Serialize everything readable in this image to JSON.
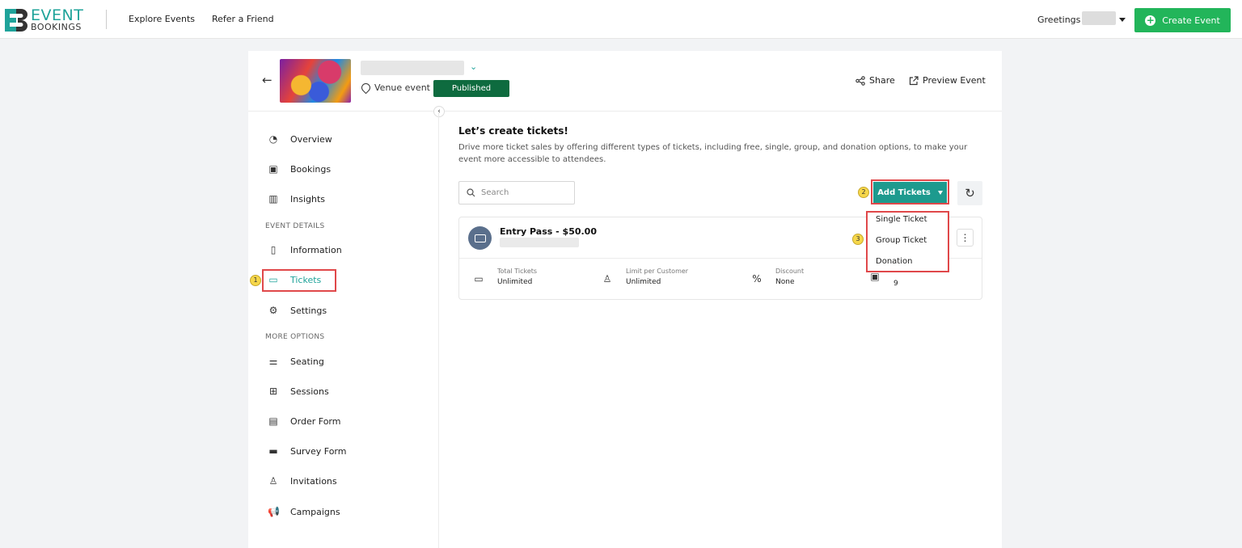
{
  "topbar": {
    "logo": {
      "event": "EVENT",
      "bookings": "BOOKINGS"
    },
    "nav": [
      {
        "label": "Explore Events"
      },
      {
        "label": "Refer a Friend"
      }
    ],
    "greeting": "Greetings!",
    "create_label": "Create Event"
  },
  "event": {
    "venue_label": "Venue event",
    "status": "Published",
    "share_label": "Share",
    "preview_label": "Preview Event"
  },
  "sidebar": {
    "items_top": [
      {
        "label": "Overview",
        "icon": "gauge-icon"
      },
      {
        "label": "Bookings",
        "icon": "calendar-icon"
      },
      {
        "label": "Insights",
        "icon": "bar-chart-icon"
      }
    ],
    "event_details_heading": "EVENT DETAILS",
    "items_details": [
      {
        "label": "Information",
        "icon": "document-icon"
      },
      {
        "label": "Tickets",
        "icon": "ticket-icon"
      },
      {
        "label": "Settings",
        "icon": "gear-icon"
      }
    ],
    "more_options_heading": "MORE OPTIONS",
    "items_more": [
      {
        "label": "Seating",
        "icon": "sliders-icon"
      },
      {
        "label": "Sessions",
        "icon": "grid-icon"
      },
      {
        "label": "Order Form",
        "icon": "form-icon"
      },
      {
        "label": "Survey Form",
        "icon": "survey-icon"
      },
      {
        "label": "Invitations",
        "icon": "user-icon"
      },
      {
        "label": "Campaigns",
        "icon": "megaphone-icon"
      }
    ]
  },
  "main": {
    "title": "Let’s create tickets!",
    "description": "Drive more ticket sales by offering different types of tickets, including free, single, group, and donation options, to make your event more accessible to attendees.",
    "search_placeholder": "Search",
    "add_tickets_label": "Add Tickets",
    "dropdown": [
      "Single Ticket",
      "Group Ticket",
      "Donation"
    ],
    "ticket": {
      "name": "Entry Pass - $50.00",
      "stats": [
        {
          "label": "Total Tickets",
          "value": "Unlimited",
          "icon": "ticket-icon"
        },
        {
          "label": "Limit per Customer",
          "value": "Unlimited",
          "icon": "user-icon"
        },
        {
          "label": "Discount",
          "value": "None",
          "icon": "percent-icon"
        },
        {
          "label": "",
          "value": "9",
          "icon": "cash-icon"
        }
      ]
    }
  },
  "annotations": [
    "1",
    "2",
    "3"
  ],
  "colors": {
    "accent": "#1fa39a",
    "create": "#22b55a",
    "published": "#0e6b3f",
    "highlight": "#e0484a"
  }
}
